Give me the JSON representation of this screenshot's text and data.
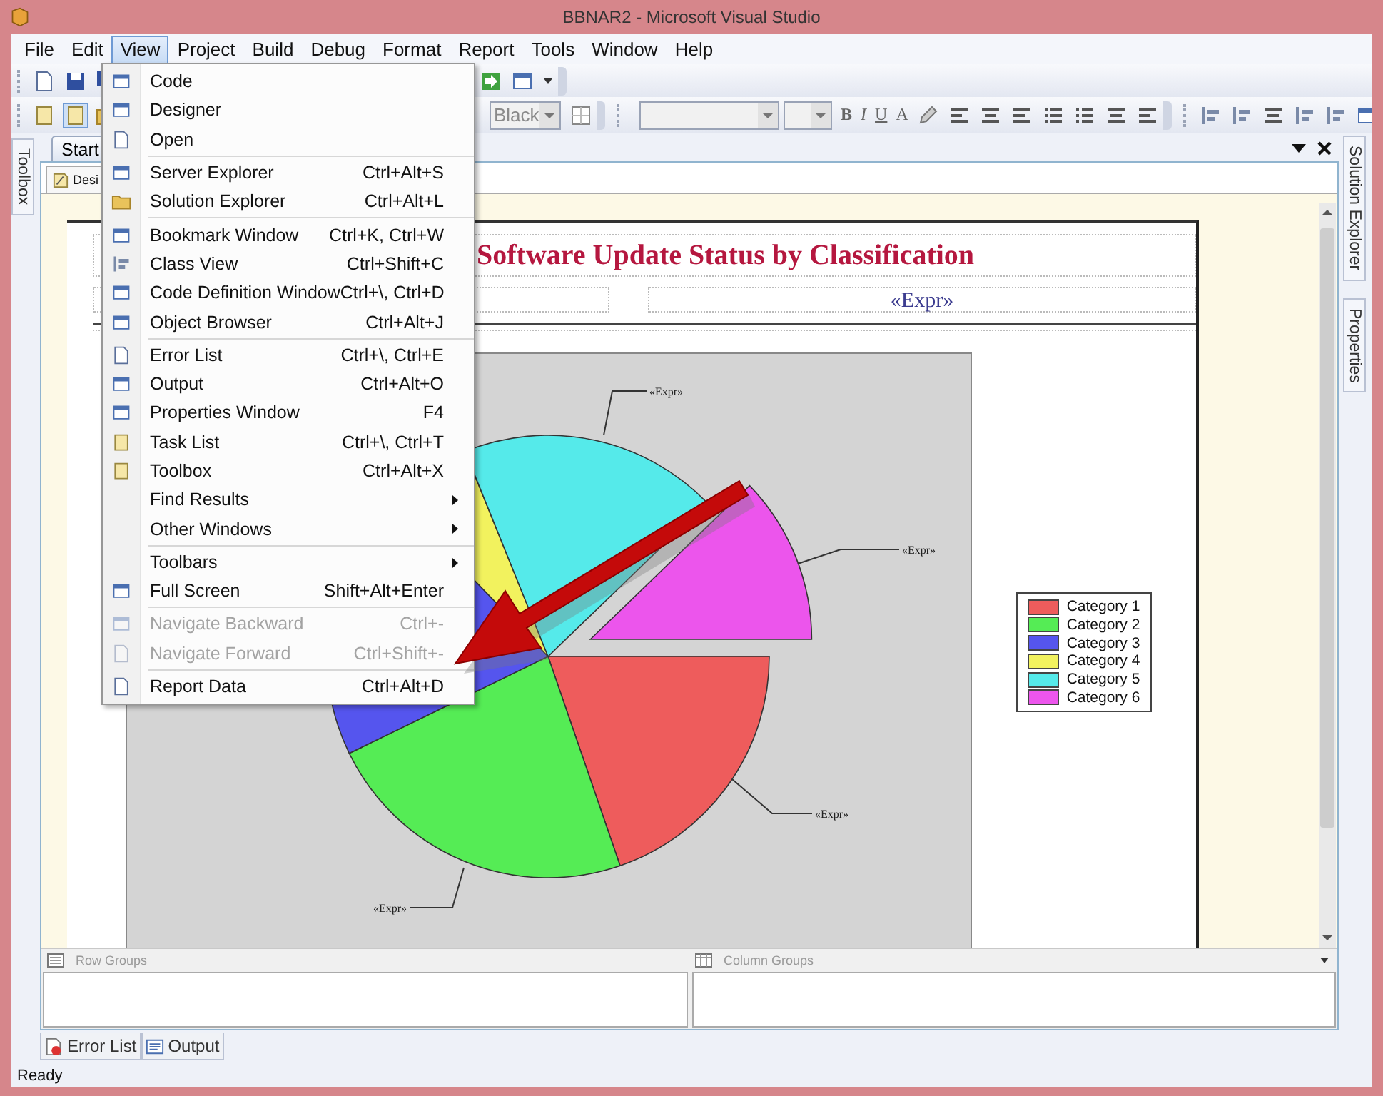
{
  "window": {
    "title": "BBNAR2 - Microsoft Visual Studio"
  },
  "menu_bar": [
    {
      "label": "File",
      "selected": false
    },
    {
      "label": "Edit",
      "selected": false
    },
    {
      "label": "View",
      "selected": true
    },
    {
      "label": "Project",
      "selected": false
    },
    {
      "label": "Build",
      "selected": false
    },
    {
      "label": "Debug",
      "selected": false
    },
    {
      "label": "Format",
      "selected": false
    },
    {
      "label": "Report",
      "selected": false
    },
    {
      "label": "Tools",
      "selected": false
    },
    {
      "label": "Window",
      "selected": false
    },
    {
      "label": "Help",
      "selected": false
    }
  ],
  "view_menu": {
    "groups": [
      {
        "items": [
          {
            "label": "Code",
            "has_icon": true,
            "submenu": false,
            "disabled": false
          },
          {
            "label": "Designer",
            "has_icon": true,
            "submenu": false,
            "disabled": false
          },
          {
            "label": "Open",
            "has_icon": true,
            "submenu": false,
            "disabled": false
          }
        ]
      },
      {
        "items": [
          {
            "label": "Server Explorer",
            "shortcut": "Ctrl+Alt+S",
            "has_icon": true,
            "submenu": false,
            "disabled": false
          },
          {
            "label": "Solution Explorer",
            "shortcut": "Ctrl+Alt+L",
            "has_icon": true,
            "submenu": false,
            "disabled": false
          }
        ]
      },
      {
        "items": [
          {
            "label": "Bookmark Window",
            "shortcut": "Ctrl+K, Ctrl+W",
            "has_icon": true,
            "submenu": false,
            "disabled": false
          },
          {
            "label": "Class View",
            "shortcut": "Ctrl+Shift+C",
            "has_icon": true,
            "submenu": false,
            "disabled": false
          },
          {
            "label": "Code Definition Window",
            "shortcut": "Ctrl+\\, Ctrl+D",
            "has_icon": true,
            "submenu": false,
            "disabled": false
          },
          {
            "label": "Object Browser",
            "shortcut": "Ctrl+Alt+J",
            "has_icon": true,
            "submenu": false,
            "disabled": false
          }
        ]
      },
      {
        "items": [
          {
            "label": "Error List",
            "shortcut": "Ctrl+\\, Ctrl+E",
            "has_icon": true,
            "submenu": false,
            "disabled": false
          },
          {
            "label": "Output",
            "shortcut": "Ctrl+Alt+O",
            "has_icon": true,
            "submenu": false,
            "disabled": false
          },
          {
            "label": "Properties Window",
            "shortcut": "F4",
            "has_icon": true,
            "submenu": false,
            "disabled": false
          },
          {
            "label": "Task List",
            "shortcut": "Ctrl+\\, Ctrl+T",
            "has_icon": true,
            "submenu": false,
            "disabled": false
          },
          {
            "label": "Toolbox",
            "shortcut": "Ctrl+Alt+X",
            "has_icon": true,
            "submenu": false,
            "disabled": false
          },
          {
            "label": "Find Results",
            "has_icon": false,
            "submenu": true,
            "disabled": false
          },
          {
            "label": "Other Windows",
            "has_icon": false,
            "submenu": true,
            "disabled": false
          }
        ]
      },
      {
        "items": [
          {
            "label": "Toolbars",
            "has_icon": false,
            "submenu": true,
            "disabled": false
          },
          {
            "label": "Full Screen",
            "shortcut": "Shift+Alt+Enter",
            "has_icon": true,
            "submenu": false,
            "disabled": false
          }
        ]
      },
      {
        "items": [
          {
            "label": "Navigate Backward",
            "shortcut": "Ctrl+-",
            "has_icon": true,
            "submenu": false,
            "disabled": true
          },
          {
            "label": "Navigate Forward",
            "shortcut": "Ctrl+Shift+-",
            "has_icon": true,
            "submenu": false,
            "disabled": true
          }
        ]
      },
      {
        "items": [
          {
            "label": "Report Data",
            "shortcut": "Ctrl+Alt+D",
            "has_icon": true,
            "submenu": false,
            "disabled": false
          }
        ]
      }
    ]
  },
  "toolbar": {
    "color_combo": "Black",
    "format_buttons": [
      "B",
      "I",
      "U",
      "A"
    ]
  },
  "left_side_tabs": [
    "Toolbox"
  ],
  "right_side_tabs": [
    "Solution Explorer",
    "Properties"
  ],
  "document_tabs": [
    {
      "label": "Start",
      "selected": false
    }
  ],
  "designer_tab": "Desi",
  "report": {
    "title": "Software Update Status by Classification",
    "expression": "«Expr»",
    "chart": {
      "slice_labels": [
        "«Expr»",
        "«Expr»",
        "«Expr»",
        "«Expr»"
      ],
      "legend": [
        {
          "label": "Category 1",
          "color": "#ee5c5c"
        },
        {
          "label": "Category 2",
          "color": "#55ec55"
        },
        {
          "label": "Category 3",
          "color": "#5555ee"
        },
        {
          "label": "Category 4",
          "color": "#f2f25e"
        },
        {
          "label": "Category 5",
          "color": "#55eaea"
        },
        {
          "label": "Category 6",
          "color": "#ec55ec"
        }
      ]
    }
  },
  "groups_panel": {
    "row_groups": "Row Groups",
    "column_groups": "Column Groups"
  },
  "bottom_tabs": [
    {
      "label": "Error List",
      "selected": false
    },
    {
      "label": "Output",
      "selected": false
    }
  ],
  "status_bar": {
    "text": "Ready"
  }
}
